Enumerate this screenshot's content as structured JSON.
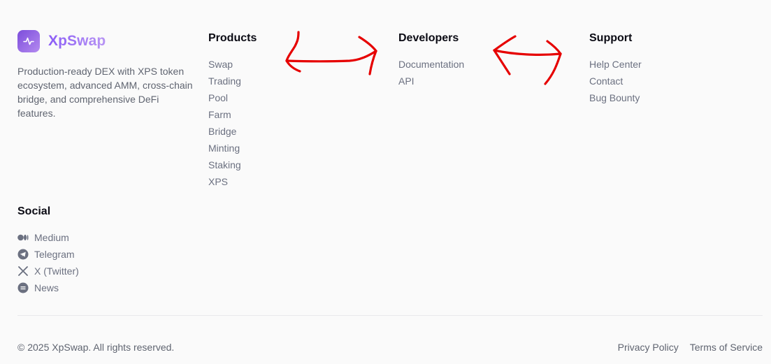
{
  "brand": {
    "name": "XpSwap",
    "logo_icon": "activity-pulse-icon",
    "description": "Production-ready DEX with XPS token ecosystem, advanced AMM, cross-chain bridge, and comprehensive DeFi features."
  },
  "columns": {
    "products": {
      "title": "Products",
      "items": [
        "Swap",
        "Trading",
        "Pool",
        "Farm",
        "Bridge",
        "Minting",
        "Staking",
        "XPS"
      ]
    },
    "developers": {
      "title": "Developers",
      "items": [
        "Documentation",
        "API"
      ]
    },
    "support": {
      "title": "Support",
      "items": [
        "Help Center",
        "Contact",
        "Bug Bounty"
      ]
    }
  },
  "social": {
    "title": "Social",
    "items": [
      {
        "label": "Medium",
        "icon": "medium-icon"
      },
      {
        "label": "Telegram",
        "icon": "telegram-icon"
      },
      {
        "label": "X (Twitter)",
        "icon": "x-twitter-icon"
      },
      {
        "label": "News",
        "icon": "news-icon"
      }
    ]
  },
  "footer": {
    "copyright": "© 2025 XpSwap. All rights reserved.",
    "privacy": "Privacy Policy",
    "terms": "Terms of Service"
  },
  "colors": {
    "background": "#fafafa",
    "brand_purple": "#8b5cf6",
    "annotation_red": "#e60000",
    "link_gray": "#6b7080"
  }
}
